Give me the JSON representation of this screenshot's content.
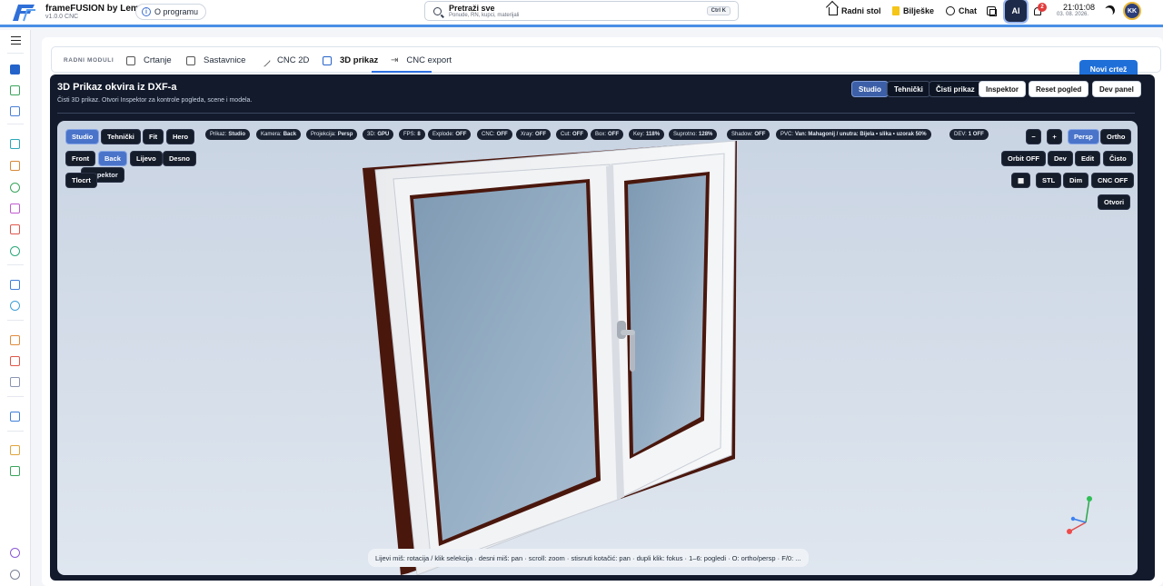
{
  "app": {
    "title": "frameFUSION by Lemy",
    "version": "v1.0.0 CNC",
    "about": "O programu"
  },
  "search": {
    "title": "Pretraži sve",
    "subtitle": "Ponude, RN, kupci, materijali",
    "shortcut": "Ctrl K"
  },
  "topnav": {
    "dashboard": "Radni stol",
    "notes": "Bilješke",
    "chat": "Chat",
    "ai": "AI",
    "notifications": "2",
    "time": "21:01:08",
    "date": "03. 08. 2026.",
    "avatar": "KK"
  },
  "modules": {
    "label": "RADNI MODULI",
    "tabs": [
      "Crtanje",
      "Sastavnice",
      "CNC 2D",
      "3D prikaz",
      "CNC export"
    ],
    "active": "3D prikaz",
    "new_button": "Novi crtež"
  },
  "viewer": {
    "title": "3D Prikaz okvira iz DXF-a",
    "subtitle": "Čisti 3D prikaz. Otvori Inspektor za kontrole pogleda, scene i modela.",
    "header_buttons": [
      "Studio",
      "Tehnički",
      "Čisti prikaz",
      "Inspektor",
      "Reset pogled",
      "Dev panel"
    ],
    "left_buttons_row1": [
      "Studio",
      "Tehnički",
      "Fit",
      "Hero"
    ],
    "left_buttons_row2": [
      "Front",
      "Back",
      "Lijevo",
      "Desno"
    ],
    "left_buttons_row3": [
      "Tlocrt",
      "Inspektor"
    ],
    "status_chips": [
      {
        "k": "Prikaz:",
        "v": "Studio"
      },
      {
        "k": "Kamera:",
        "v": "Back"
      },
      {
        "k": "Projekcija:",
        "v": "Persp"
      },
      {
        "k": "3D:",
        "v": "GPU"
      },
      {
        "k": "FPS:",
        "v": "8"
      },
      {
        "k": "Explode:",
        "v": "OFF"
      },
      {
        "k": "CNC:",
        "v": "OFF"
      },
      {
        "k": "Xray:",
        "v": "OFF"
      },
      {
        "k": "Cut:",
        "v": "OFF"
      },
      {
        "k": "Box:",
        "v": "OFF"
      },
      {
        "k": "Key:",
        "v": "118%"
      },
      {
        "k": "Suprotno:",
        "v": "128%"
      },
      {
        "k": "Shadow:",
        "v": "OFF"
      },
      {
        "k": "PVC:",
        "v": "Van: Mahagonij / unutra: Bijela • slika • uzorak 50%"
      },
      {
        "k": "DEV:",
        "v": "1 OFF"
      }
    ],
    "right_buttons_row1": [
      "−",
      "+",
      "Persp",
      "Ortho"
    ],
    "right_buttons_row2": [
      "Orbit OFF",
      "Dev",
      "Edit",
      "Čisto"
    ],
    "right_buttons_row3": [
      "▦",
      "STL",
      "Dim",
      "CNC OFF"
    ],
    "right_buttons_row4": [
      "Otvori"
    ],
    "hint": "Lijevi miš: rotacija / klik selekcija · desni miš: pan · scroll: zoom · stisnuti kotačić: pan · dupli klik: fokus · 1–6: pogledi · O: ortho/persp · F/0: ..."
  },
  "colors": {
    "accent": "#1f6fd9",
    "viewer_bg": "#121a2b",
    "frame_outer": "#5a1e12",
    "frame_inner": "#f4f5f6",
    "glass": "#8aa6c0"
  }
}
